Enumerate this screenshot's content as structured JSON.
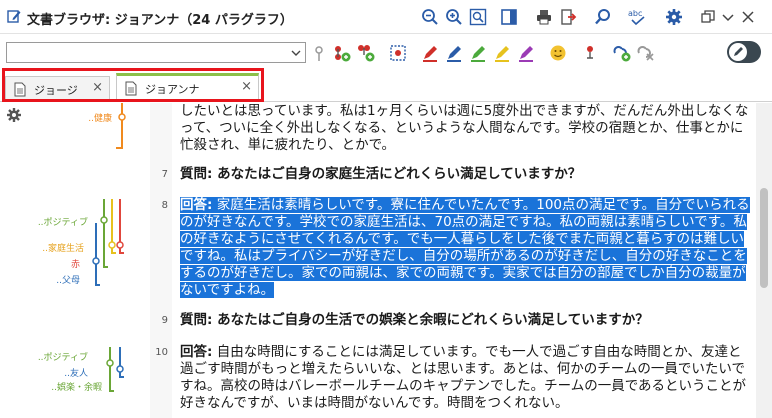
{
  "window": {
    "title": "文書ブラウザ: ジョアンナ（24 パラグラフ）"
  },
  "toolbar": {
    "spell_label": "abc",
    "search_value": "",
    "icons": [
      "zoom-out-icon",
      "zoom-in-icon",
      "zoom-reset-icon",
      "panel-toggle-icon",
      "print-icon",
      "export-icon",
      "search-icon",
      "spellcheck-icon",
      "settings-icon",
      "restore-window-icon",
      "minimize-icon",
      "close-icon"
    ]
  },
  "tabs": [
    {
      "label": "ジョージ",
      "active": false
    },
    {
      "label": "ジョアンナ",
      "active": true
    }
  ],
  "codes": {
    "group1": [
      "..健康"
    ],
    "group2": [
      "..ポジティブ",
      "..家庭生活",
      "赤",
      "..父母"
    ],
    "group3": [
      "..ポジティブ",
      "..友人",
      "..娯楽・余暇"
    ]
  },
  "colors": {
    "highlight": "#1a73d9",
    "orange": "#f08a1e",
    "green": "#6aa636",
    "blue": "#2d6eb8",
    "red": "#e0463c",
    "yellow": "#e6c21e",
    "tab_accent": "#8cc04a",
    "callout": "#e8141c"
  },
  "paragraphs": [
    {
      "num": "",
      "type": "answer-tail",
      "text": "したいとは思っています。私は1ヶ月くらいは週に5度外出できますが、だんだん外出しなくなって、ついに全く外出しなくなる、というような人間なんです。学校の宿題とか、仕事とかに忙殺され、単に疲れたり、とかで。"
    },
    {
      "num": "7",
      "type": "question",
      "text": "質問: あなたはご自身の家庭生活にどれくらい満足していますか？"
    },
    {
      "num": "8",
      "type": "answer",
      "label": "回答:",
      "text": " 家庭生活は素晴らしいです。寮に住んでいたんです。100点の満足です。自分でいられるのが好きなんです。学校での家庭生活は、70点の満足ですね。私の両親は素晴らしいです。私の好きなようにさせてくれるんです。でも一人暮らしをした後でまた両親と暮らすのは難しいですね。私はプライバシーが好きだし、自分の場所があるのが好きだし、自分の好きなことをするのが好きだし。家での両親は、家での両親です。実家では自分の部屋でしか自分の裁量がないですよね。"
    },
    {
      "num": "9",
      "type": "question",
      "text": "質問: あなたはご自身の生活での娯楽と余暇にどれくらい満足していますか？"
    },
    {
      "num": "10",
      "type": "answer",
      "label": "回答:",
      "text": " 自由な時間にすることには満足しています。でも一人で過ごす自由な時間とか、友達と過ごす時間がもっと増えたらいいな、とは思います。あとは、何かのチームの一員でいたいですね。高校の時はバレーボールチームのキャプテンでした。チームの一員であるということが好きなんですが、いまは時間がないんです。時間をつくれない。"
    }
  ]
}
